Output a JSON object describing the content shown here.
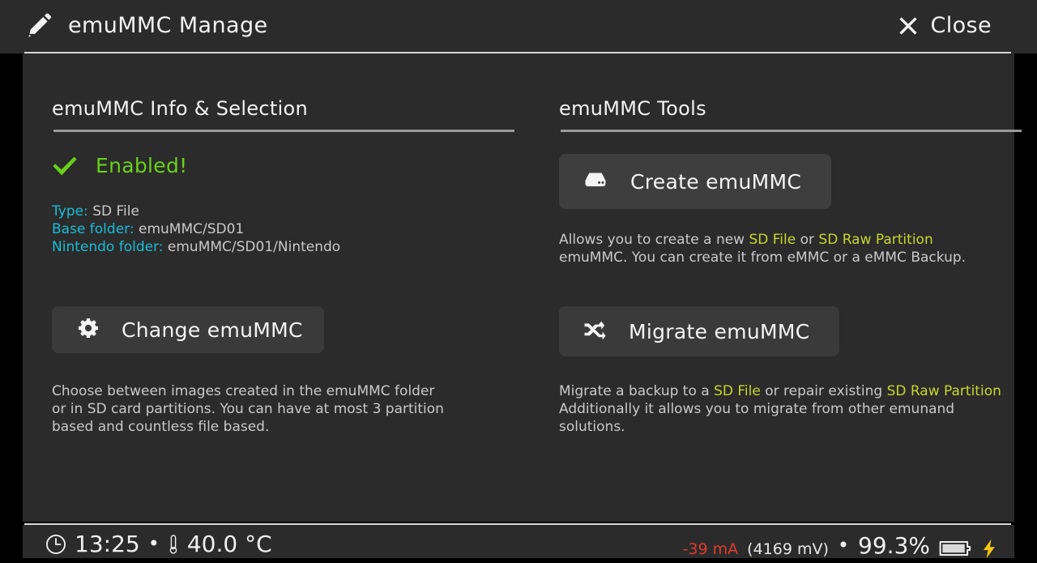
{
  "titlebar": {
    "icon": "pencil-icon",
    "title": "emuMMC Manage",
    "close_label": "Close",
    "close_icon": "close-x-icon"
  },
  "left_panel": {
    "section_title": "emuMMC Info & Selection",
    "status": {
      "icon": "checkmark-icon",
      "text": "Enabled!",
      "color": "#69d01a"
    },
    "info": [
      {
        "key": "Type:",
        "value": "SD File"
      },
      {
        "key": "Base folder:",
        "value": "emuMMC/SD01"
      },
      {
        "key": "Nintendo folder:",
        "value": "emuMMC/SD01/Nintendo"
      }
    ],
    "change_button": {
      "icon": "gear-icon",
      "label": "Change emuMMC"
    },
    "description": {
      "line1": "Choose between images created in the emuMMC folder",
      "line2": "or in SD card partitions. You can have at most 3 partition",
      "line3": "based and countless file based."
    }
  },
  "right_panel": {
    "section_title": "emuMMC Tools",
    "create_button": {
      "icon": "hard-drive-icon",
      "label": "Create emuMMC"
    },
    "create_description": {
      "p1": "Allows you to create a new ",
      "hl1": "SD File",
      "p2": " or ",
      "hl2": "SD Raw Partition",
      "p3": "emuMMC. You can create it from eMMC or a eMMC Backup."
    },
    "migrate_button": {
      "icon": "shuffle-icon",
      "label": "Migrate emuMMC"
    },
    "migrate_description": {
      "p1": "Migrate a backup to a ",
      "hl1": "SD File",
      "p2": " or repair existing ",
      "hl2": "SD Raw Partition",
      "p3": "Additionally it allows you to migrate from other emunand",
      "p4": "solutions."
    }
  },
  "statusbar": {
    "clock_icon": "clock-icon",
    "time": "13:25",
    "separator": "•",
    "temp_icon": "thermometer-icon",
    "temperature": "40.0 °C",
    "current": "-39 mA",
    "voltage": "(4169 mV)",
    "separator2": "•",
    "battery_percent": "99.3%",
    "battery_icon": "battery-icon",
    "charging_icon": "lightning-bolt-icon"
  },
  "colors": {
    "background": "#2b2b2b",
    "frame": "#000000",
    "accent_cyan": "#19bcd8",
    "accent_green": "#69d01a",
    "accent_yellow_green": "#c6d62c",
    "accent_red": "#e03b2e",
    "accent_bolt": "#f5c518",
    "button": "#3a3a3a",
    "button_focus": "#3e3e3e",
    "text": "#f2f2f2",
    "text_dim": "#c9c9c9"
  }
}
